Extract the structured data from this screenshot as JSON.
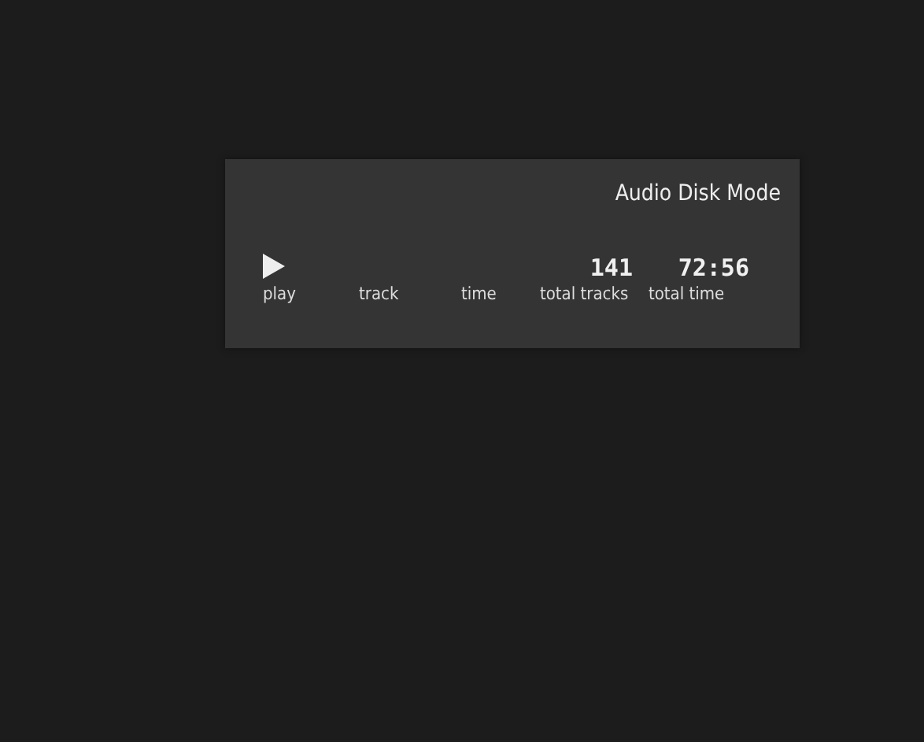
{
  "panel": {
    "title": "Audio Disk Mode",
    "fields": [
      {
        "kind": "play",
        "label": "play"
      },
      {
        "kind": "text",
        "label": "track"
      },
      {
        "kind": "text",
        "label": "time"
      },
      {
        "kind": "text",
        "label": "total tracks",
        "value": "141"
      },
      {
        "kind": "text",
        "label": "total time",
        "value": "72:56"
      }
    ]
  }
}
